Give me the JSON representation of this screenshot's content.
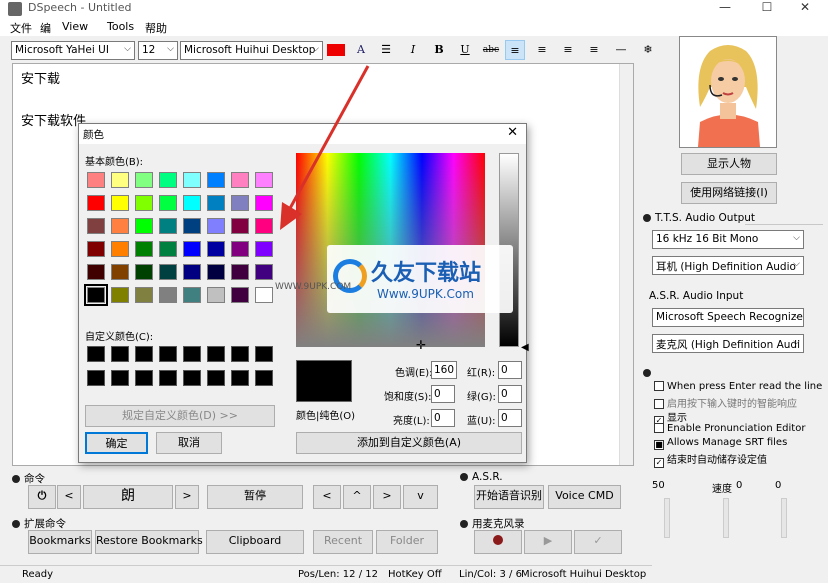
{
  "window": {
    "title": "DSpeech - Untitled",
    "min": "—",
    "max": "☐",
    "close": "✕"
  },
  "menu": [
    "文件",
    "编",
    "View",
    "Tools",
    "帮助"
  ],
  "toolbar": {
    "font": "Microsoft YaHei UI",
    "size": "12",
    "voice": "Microsoft Huihui Desktop",
    "bold": "B",
    "italic": "I",
    "underline": "U",
    "strike": "abc"
  },
  "editor": {
    "line1": "安下载",
    "line2": "安下载软件"
  },
  "dialog": {
    "title": "颜色",
    "basic_label": "基本颜色(B):",
    "custom_label": "自定义颜色(C):",
    "define_btn": "规定自定义颜色(D) >>",
    "ok": "确定",
    "cancel": "取消",
    "color_solid": "颜色|纯色(O)",
    "add_btn": "添加到自定义颜色(A)",
    "hue_label": "色调(E):",
    "hue": "160",
    "sat_label": "饱和度(S):",
    "sat": "0",
    "lum_label": "亮度(L):",
    "lum": "0",
    "red_label": "红(R):",
    "red": "0",
    "green_label": "绿(G):",
    "green": "0",
    "blue_label": "蓝(U):",
    "blue": "0",
    "basic_colors": [
      "#ff8080",
      "#ffff80",
      "#80ff80",
      "#00ff80",
      "#80ffff",
      "#0080ff",
      "#ff80c0",
      "#ff80ff",
      "#ff0000",
      "#ffff00",
      "#80ff00",
      "#00ff40",
      "#00ffff",
      "#0080c0",
      "#8080c0",
      "#ff00ff",
      "#804040",
      "#ff8040",
      "#00ff00",
      "#008080",
      "#004080",
      "#8080ff",
      "#800040",
      "#ff0080",
      "#800000",
      "#ff8000",
      "#008000",
      "#008040",
      "#0000ff",
      "#0000a0",
      "#800080",
      "#8000ff",
      "#400000",
      "#804000",
      "#004000",
      "#004040",
      "#000080",
      "#000040",
      "#400040",
      "#400080",
      "#000000",
      "#808000",
      "#808040",
      "#808080",
      "#408080",
      "#c0c0c0",
      "#400040",
      "#ffffff"
    ],
    "custom_colors": [
      "#000000",
      "#000000",
      "#000000",
      "#000000",
      "#000000",
      "#000000",
      "#000000",
      "#000000",
      "#000000",
      "#000000",
      "#000000",
      "#000000",
      "#000000",
      "#000000",
      "#000000",
      "#000000"
    ]
  },
  "watermark": {
    "brand": "久友下载站",
    "url": "Www.9UPK.Com",
    "small": "WWW.9UPK.COM"
  },
  "right": {
    "show_person": "显示人物",
    "use_network": "使用网络链接(I)",
    "tts_label": "T.T.S. Audio Output",
    "tts_rate": "16 kHz 16 Bit Mono",
    "tts_device": "耳机 (High Definition Audio",
    "asr_label": "A.S.R. Audio Input",
    "asr_engine": "Microsoft Speech Recognizer",
    "asr_device": "麦克风 (High Definition Audi",
    "options": [
      {
        "label": "When press Enter read the line",
        "checked": false
      },
      {
        "label": "启用按下输入键时的智能响应",
        "checked": false
      },
      {
        "label": "显示",
        "checked": true
      },
      {
        "label": "Enable Pronunciation Editor",
        "checked": false
      },
      {
        "label": "Allows Manage SRT files",
        "checked": true
      },
      {
        "label": "结束时自动储存设定值",
        "checked": true
      }
    ]
  },
  "command": {
    "label": "命令",
    "read_char": "朗",
    "pause": "暂停"
  },
  "asr": {
    "label": "A.S.R.",
    "start": "开始语音识别",
    "voice_cmd": "Voice CMD"
  },
  "ext": {
    "label": "扩展命令",
    "bookmarks": "Bookmarks",
    "restore": "Restore Bookmarks",
    "clipboard": "Clipboard",
    "recent": "Recent",
    "folder": "Folder"
  },
  "mic": {
    "label": "用麦克风录"
  },
  "sliders": {
    "vol": "50",
    "speed_label": "速度",
    "speed": "0",
    "pitch": "0"
  },
  "status": {
    "ready": "Ready",
    "pos": "Pos/Len: 12 / 12",
    "hotkey": "HotKey Off",
    "lincol": "Lin/Col: 3 / 6",
    "voice": "Microsoft Huihui Desktop"
  },
  "colors": {
    "accent": "#0078d7",
    "arrow": "#d9302a",
    "mark_red": "#ff0000"
  }
}
